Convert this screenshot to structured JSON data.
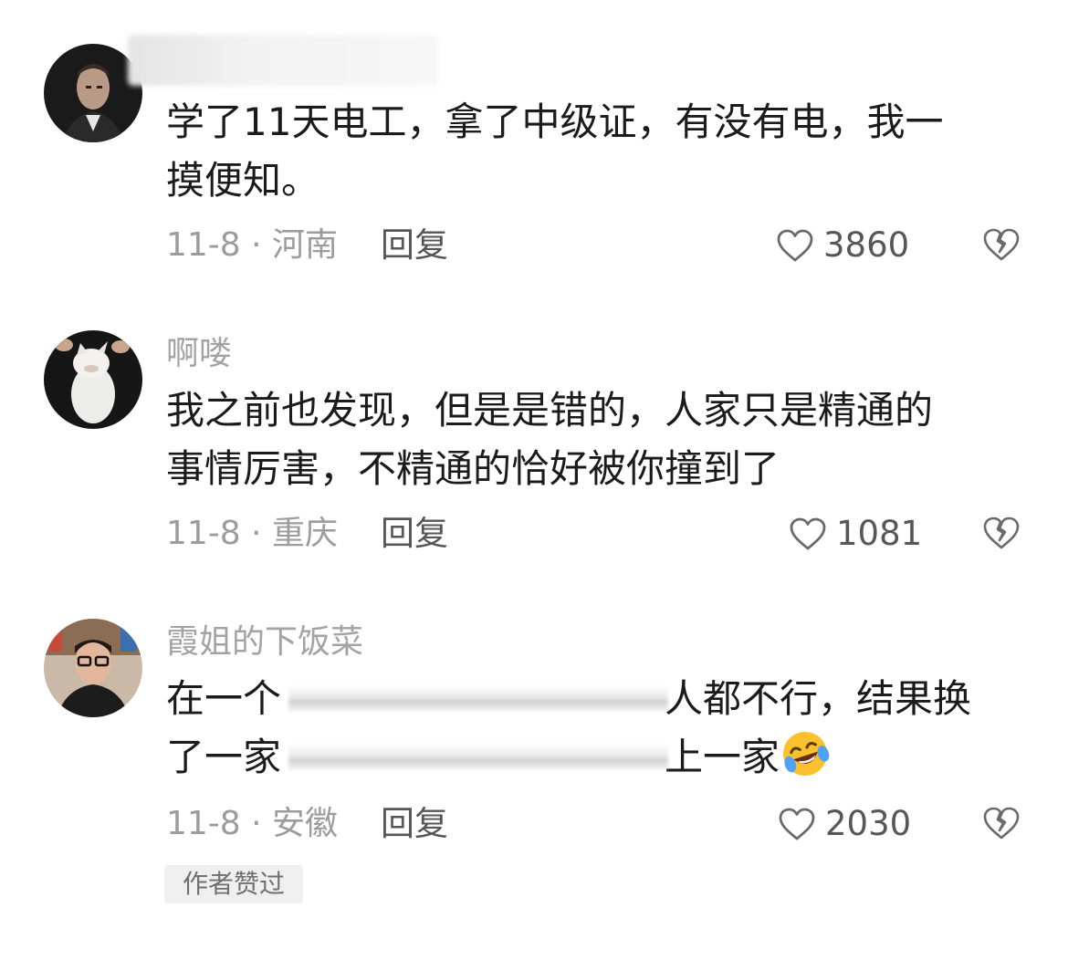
{
  "comments": [
    {
      "username": "",
      "text_line1": "学了11天电工，拿了中级证，有没有电，我一",
      "text_line2": "摸便知。",
      "date_location": "11-8 · 河南",
      "reply_label": "回复",
      "like_count": "3860",
      "like_icon": "heart-outline-icon",
      "dislike_icon": "broken-heart-icon"
    },
    {
      "username": "啊喽",
      "text_line1": "我之前也发现，但是是错的，人家只是精通的",
      "text_line2": "事情厉害，不精通的恰好被你撞到了",
      "date_location": "11-8 · 重庆",
      "reply_label": "回复",
      "like_count": "1081",
      "like_icon": "heart-outline-icon",
      "dislike_icon": "broken-heart-icon"
    },
    {
      "username": "霞姐的下饭菜",
      "text_line1_start": "在一个",
      "text_line1_end": "人都不行，结果换",
      "text_line2_start": "了一家",
      "text_line2_end": "上一家",
      "emoji": "laughing-crying-emoji",
      "date_location": "11-8 · 安徽",
      "reply_label": "回复",
      "like_count": "2030",
      "like_icon": "heart-outline-icon",
      "dislike_icon": "broken-heart-icon",
      "badge": "作者赞过"
    }
  ],
  "colors": {
    "text": "#1b1b1b",
    "muted": "#a3a3a3",
    "reply": "#565656"
  }
}
